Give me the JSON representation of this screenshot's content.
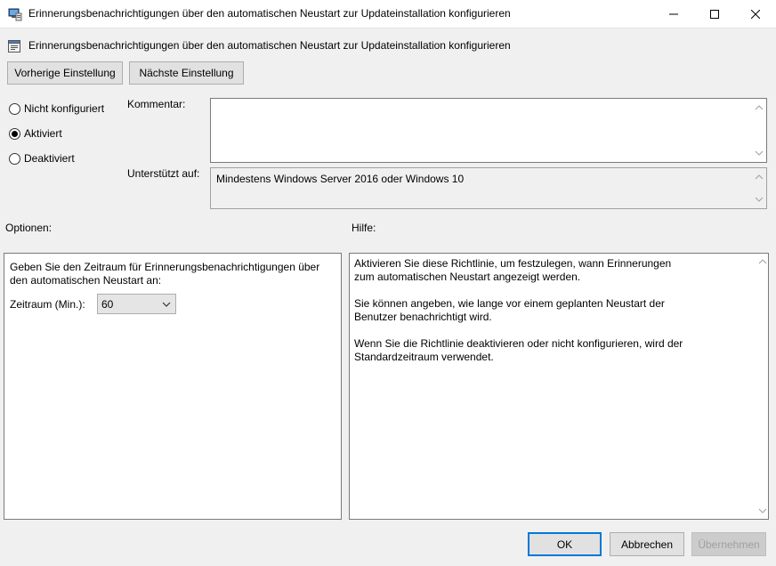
{
  "window": {
    "title": "Erinnerungsbenachrichtigungen über den automatischen Neustart zur Updateinstallation konfigurieren",
    "min_icon": "minimize-icon",
    "max_icon": "maximize-icon",
    "close_icon": "close-icon"
  },
  "header": {
    "title": "Erinnerungsbenachrichtigungen über den automatischen Neustart zur Updateinstallation konfigurieren",
    "icon": "policy-setting-icon"
  },
  "nav": {
    "previous": "Vorherige Einstellung",
    "next": "Nächste Einstellung"
  },
  "state": {
    "options": [
      {
        "label": "Nicht konfiguriert",
        "checked": false
      },
      {
        "label": "Aktiviert",
        "checked": true
      },
      {
        "label": "Deaktiviert",
        "checked": false
      }
    ]
  },
  "comment": {
    "label": "Kommentar:",
    "value": ""
  },
  "supported": {
    "label": "Unterstützt auf:",
    "value": "Mindestens Windows Server 2016 oder Windows 10"
  },
  "options": {
    "heading": "Optionen:",
    "description": "Geben Sie den Zeitraum für Erinnerungsbenachrichtigungen über den automatischen Neustart an:",
    "period_label": "Zeitraum (Min.):",
    "period_value": "60"
  },
  "help": {
    "heading": "Hilfe:",
    "paragraphs": [
      "Aktivieren Sie diese Richtlinie, um festzulegen, wann Erinnerungen zum automatischen Neustart angezeigt werden.",
      "Sie können angeben, wie lange vor einem geplanten Neustart der Benutzer benachrichtigt wird.",
      "Wenn Sie die Richtlinie deaktivieren oder nicht konfigurieren, wird der Standardzeitraum verwendet."
    ]
  },
  "footer": {
    "ok": "OK",
    "cancel": "Abbrechen",
    "apply": "Übernehmen"
  },
  "colors": {
    "accent": "#0078d7",
    "window_bg": "#f0f0f0",
    "border": "#7a7a7a"
  }
}
